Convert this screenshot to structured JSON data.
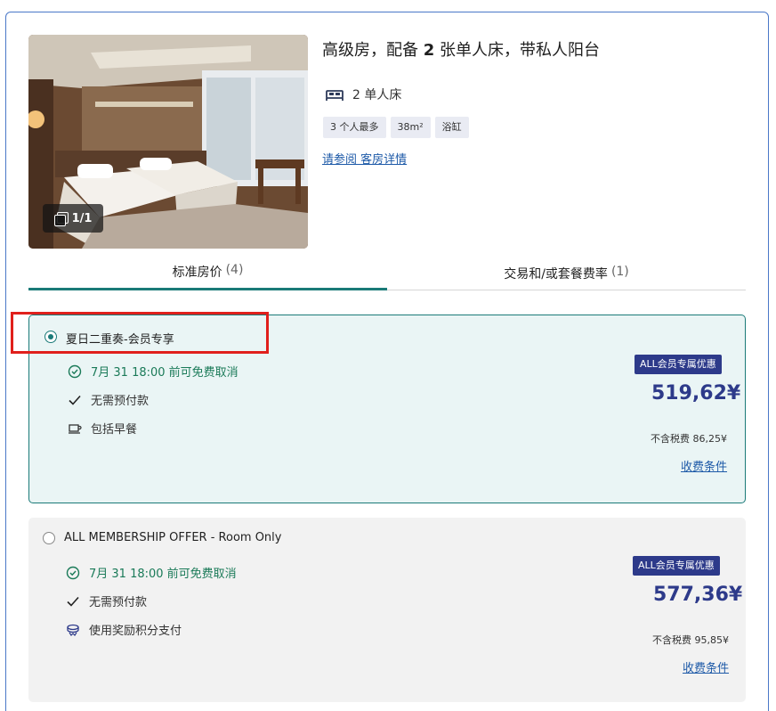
{
  "room": {
    "title_pre": "高级房，配备 ",
    "title_num": "2",
    "title_post": " 张单人床，带私人阳台",
    "photo_counter": "1/1",
    "bed_label": "2 单人床",
    "tags": [
      "3 个人最多",
      "38m²",
      "浴缸"
    ],
    "details_link": "请参阅 客房详情"
  },
  "tabs": [
    {
      "label": "标准房价",
      "count": "(4)"
    },
    {
      "label": "交易和/或套餐费率",
      "count": "(1)"
    }
  ],
  "offers": [
    {
      "name": "夏日二重奏-会员专享",
      "features": [
        "7月 31 18:00 前可免费取消",
        "无需预付款",
        "包括早餐"
      ],
      "badge": "ALL会员专属优惠",
      "price": "519,62¥",
      "tax_label": "不含税费 86,25¥",
      "terms": "收费条件"
    },
    {
      "name": "ALL MEMBERSHIP OFFER - Room Only",
      "features": [
        "7月 31 18:00 前可免费取消",
        "无需预付款",
        "使用奖励积分支付"
      ],
      "badge": "ALL会员专属优惠",
      "price": "577,36¥",
      "tax_label": "不含税费 95,85¥",
      "terms": "收费条件"
    }
  ],
  "icons": {
    "gallery": "gallery-icon",
    "bed": "bed-icon",
    "clock": "clock-check-icon",
    "check": "check-icon",
    "breakfast": "coffee-cup-icon",
    "points": "reward-points-icon"
  },
  "colors": {
    "accent": "#1a7a78",
    "price": "#2d3a8a",
    "link": "#1e5aa8",
    "highlight": "#e0201c"
  }
}
